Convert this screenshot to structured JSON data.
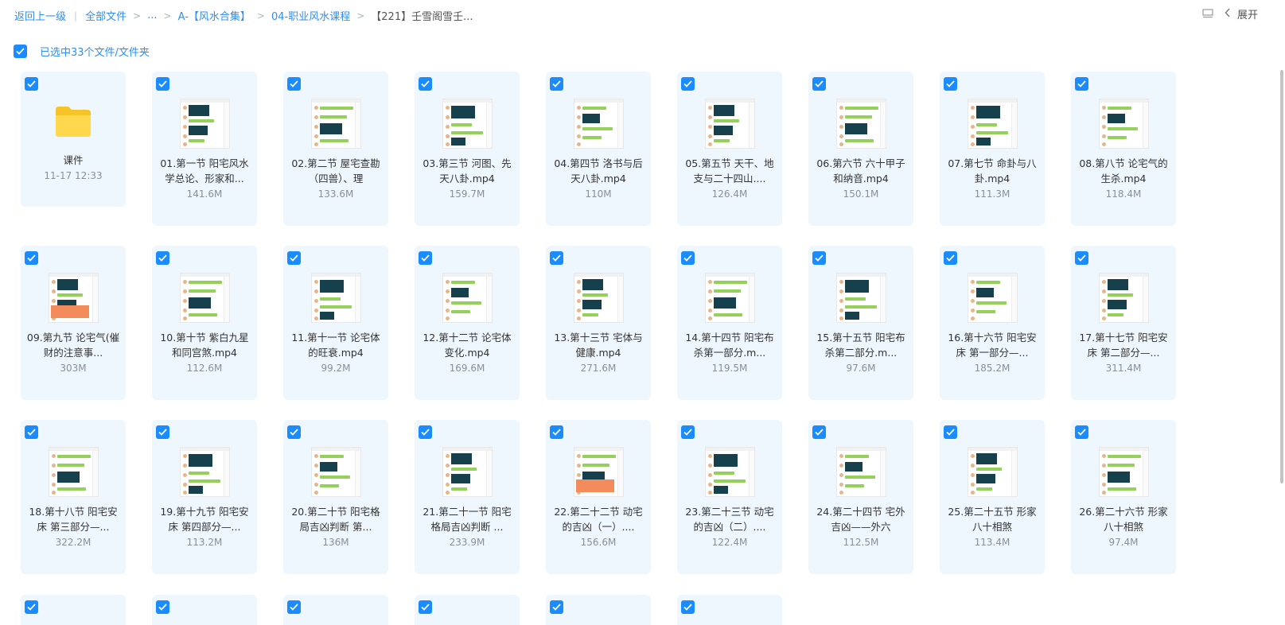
{
  "breadcrumb": {
    "back": "返回上一级",
    "all_files": "全部文件",
    "ellipsis": "...",
    "level1": "A-【风水合集】",
    "level2": "04-职业风水课程",
    "current": "【221】壬雪阁雪壬..."
  },
  "toolbar": {
    "expand_label": "展开",
    "list_icon": "list-view-icon",
    "chevron_icon": "chevron-left-icon"
  },
  "selection": {
    "label": "已选中33个文件/文件夹",
    "checked": true
  },
  "colors": {
    "accent": "#1a8cff",
    "card_bg": "#eef7fe",
    "link": "#2f8ef4"
  },
  "files": [
    {
      "type": "folder",
      "name": "课件",
      "meta": "11-17 12:33"
    },
    {
      "type": "video",
      "name": "01.第一节 阳宅风水学总论、形家和...",
      "meta": "141.6M"
    },
    {
      "type": "video",
      "name": "02.第二节 屋宅查勘（四兽）、理",
      "meta": "133.6M"
    },
    {
      "type": "video",
      "name": "03.第三节 河图、先天八卦.mp4",
      "meta": "159.7M"
    },
    {
      "type": "video",
      "name": "04.第四节 洛书与后天八卦.mp4",
      "meta": "110M"
    },
    {
      "type": "video",
      "name": "05.第五节 天干、地支与二十四山....",
      "meta": "126.4M"
    },
    {
      "type": "video",
      "name": "06.第六节 六十甲子和纳音.mp4",
      "meta": "150.1M"
    },
    {
      "type": "video",
      "name": "07.第七节 命卦与八卦.mp4",
      "meta": "111.3M"
    },
    {
      "type": "video",
      "name": "08.第八节 论宅气的生杀.mp4",
      "meta": "118.4M"
    },
    {
      "type": "video",
      "name": "09.第九节 论宅气(催财的注意事...",
      "meta": "303M"
    },
    {
      "type": "video",
      "name": "10.第十节 紫白九星和同宫煞.mp4",
      "meta": "112.6M"
    },
    {
      "type": "video",
      "name": "11.第十一节 论宅体的旺衰.mp4",
      "meta": "99.2M"
    },
    {
      "type": "video",
      "name": "12.第十二节 论宅体变化.mp4",
      "meta": "169.6M"
    },
    {
      "type": "video",
      "name": "13.第十三节 宅体与健康.mp4",
      "meta": "271.6M"
    },
    {
      "type": "video",
      "name": "14.第十四节 阳宅布杀第一部分.m...",
      "meta": "119.5M"
    },
    {
      "type": "video",
      "name": "15.第十五节 阳宅布杀第二部分.m...",
      "meta": "97.6M"
    },
    {
      "type": "video",
      "name": "16.第十六节 阳宅安床 第一部分—...",
      "meta": "185.2M"
    },
    {
      "type": "video",
      "name": "17.第十七节 阳宅安床 第二部分—...",
      "meta": "311.4M"
    },
    {
      "type": "video",
      "name": "18.第十八节 阳宅安床 第三部分—...",
      "meta": "322.2M"
    },
    {
      "type": "video",
      "name": "19.第十九节 阳宅安床 第四部分—...",
      "meta": "113.2M"
    },
    {
      "type": "video",
      "name": "20.第二十节 阳宅格局吉凶判断 第...",
      "meta": "136M"
    },
    {
      "type": "video",
      "name": "21.第二十一节 阳宅格局吉凶判断 ...",
      "meta": "233.9M"
    },
    {
      "type": "video",
      "name": "22.第二十二节 动宅的吉凶（一）....",
      "meta": "156.6M"
    },
    {
      "type": "video",
      "name": "23.第二十三节 动宅的吉凶（二）....",
      "meta": "122.4M"
    },
    {
      "type": "video",
      "name": "24.第二十四节 宅外吉凶——外六",
      "meta": "112.5M"
    },
    {
      "type": "video",
      "name": "25.第二十五节 形家八十相煞",
      "meta": "113.4M"
    },
    {
      "type": "video",
      "name": "26.第二十六节 形家八十相煞",
      "meta": "97.4M"
    }
  ],
  "partial_row_count": 6
}
